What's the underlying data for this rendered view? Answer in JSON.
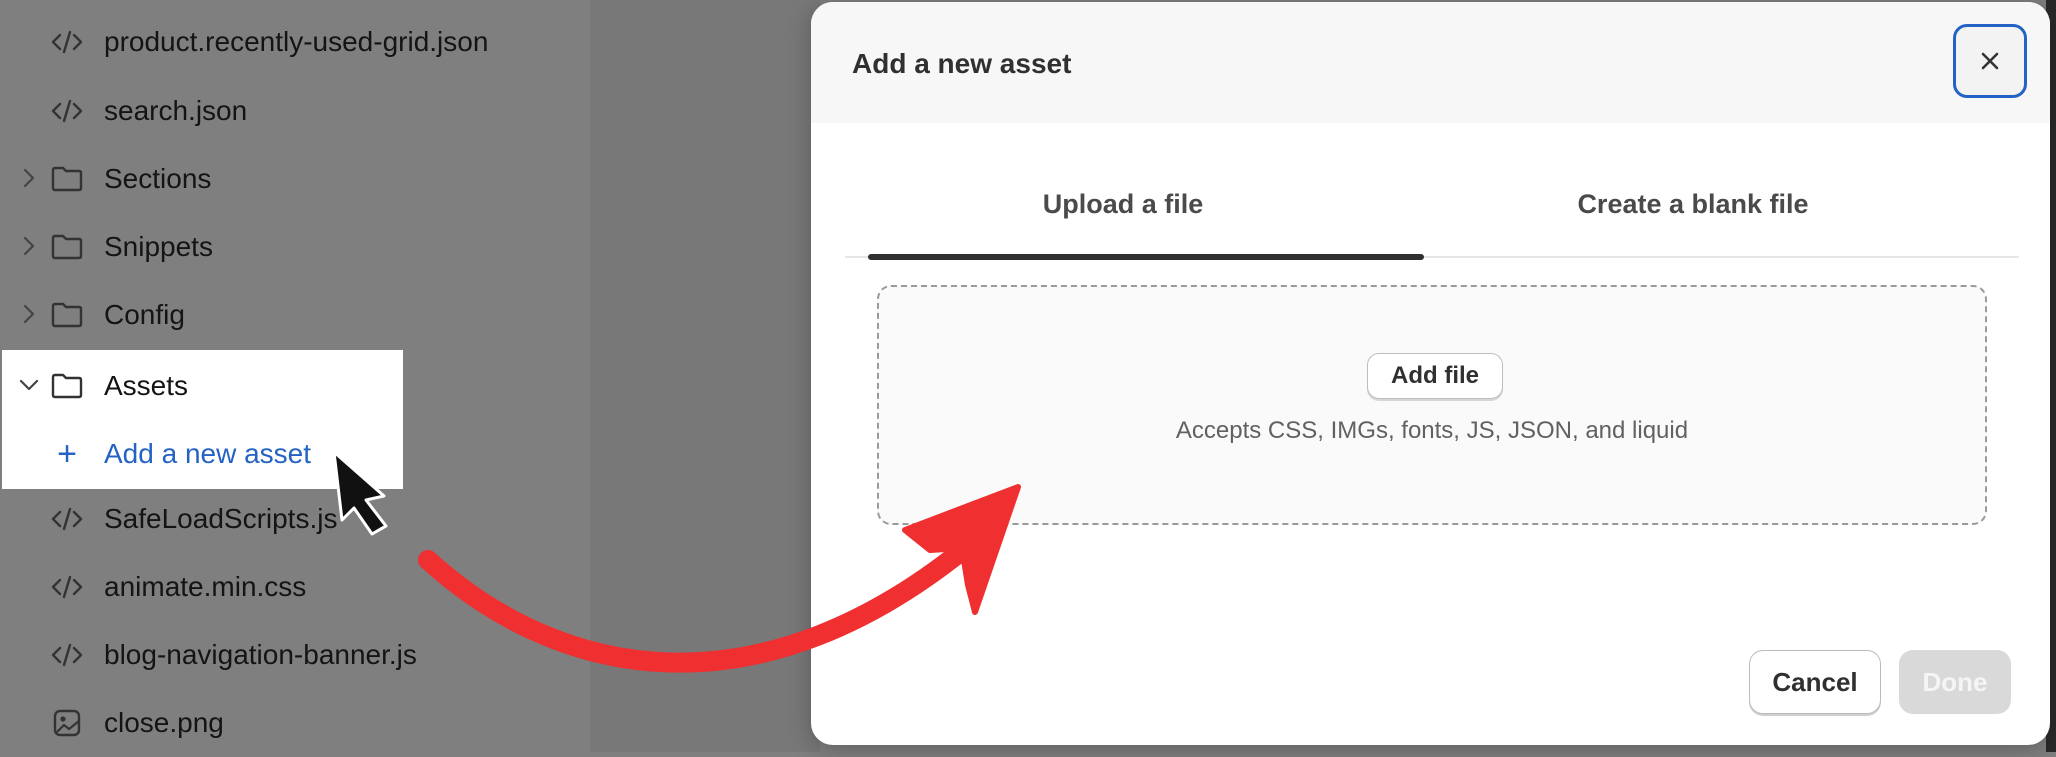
{
  "file_tree": {
    "items": [
      {
        "label": "product.recently-used-grid.json",
        "icon": "code-icon"
      },
      {
        "label": "search.json",
        "icon": "code-icon"
      },
      {
        "label": "Sections",
        "icon": "folder-icon",
        "expanded": false
      },
      {
        "label": "Snippets",
        "icon": "folder-icon",
        "expanded": false
      },
      {
        "label": "Config",
        "icon": "folder-icon",
        "expanded": false
      },
      {
        "label": "Assets",
        "icon": "folder-icon",
        "expanded": true
      },
      {
        "label": "Add a new asset",
        "icon": "plus-icon"
      },
      {
        "label": "SafeLoadScripts.js",
        "icon": "code-icon"
      },
      {
        "label": "animate.min.css",
        "icon": "code-icon"
      },
      {
        "label": "blog-navigation-banner.js",
        "icon": "code-icon"
      },
      {
        "label": "close.png",
        "icon": "image-icon"
      }
    ]
  },
  "modal": {
    "title": "Add a new asset",
    "close_label": "×",
    "tabs": [
      {
        "label": "Upload a file",
        "active": true
      },
      {
        "label": "Create a blank file",
        "active": false
      }
    ],
    "dropzone": {
      "button_label": "Add file",
      "hint": "Accepts CSS, IMGs, fonts, JS, JSON, and liquid"
    },
    "footer": {
      "cancel_label": "Cancel",
      "done_label": "Done",
      "done_disabled": true
    }
  },
  "colors": {
    "backdrop": "#7f7f7f",
    "accent_link": "#2463c4",
    "arrow": "#f03030",
    "focus_ring": "#2463c4"
  }
}
